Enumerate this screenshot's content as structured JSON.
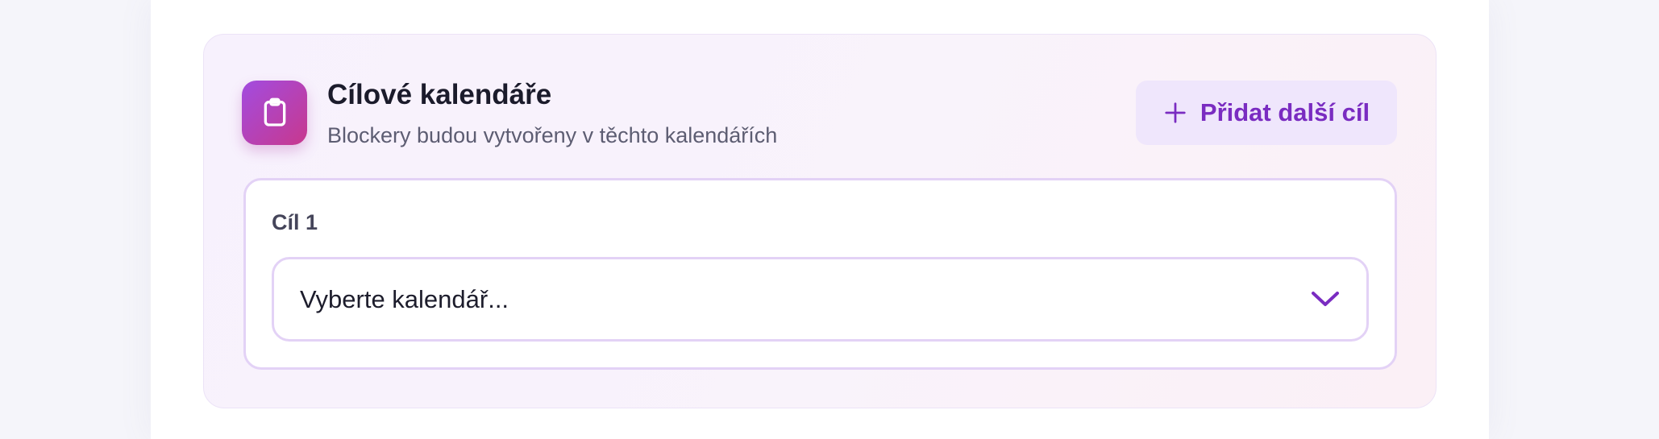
{
  "section": {
    "title": "Cílové kalendáře",
    "subtitle": "Blockery budou vytvořeny v těchto kalendářích",
    "icon": "clipboard-icon",
    "add_button": {
      "label": "Přidat další cíl",
      "icon": "plus-icon"
    }
  },
  "targets": [
    {
      "label": "Cíl 1",
      "select": {
        "value": "Vyberte kalendář...",
        "icon": "chevron-down-icon"
      }
    }
  ],
  "colors": {
    "accent": "#7a2cc1",
    "icon_gradient_start": "#a24ce0",
    "icon_gradient_end": "#c8388d",
    "button_background": "#efe6fc",
    "border": "#e3d2f6"
  }
}
